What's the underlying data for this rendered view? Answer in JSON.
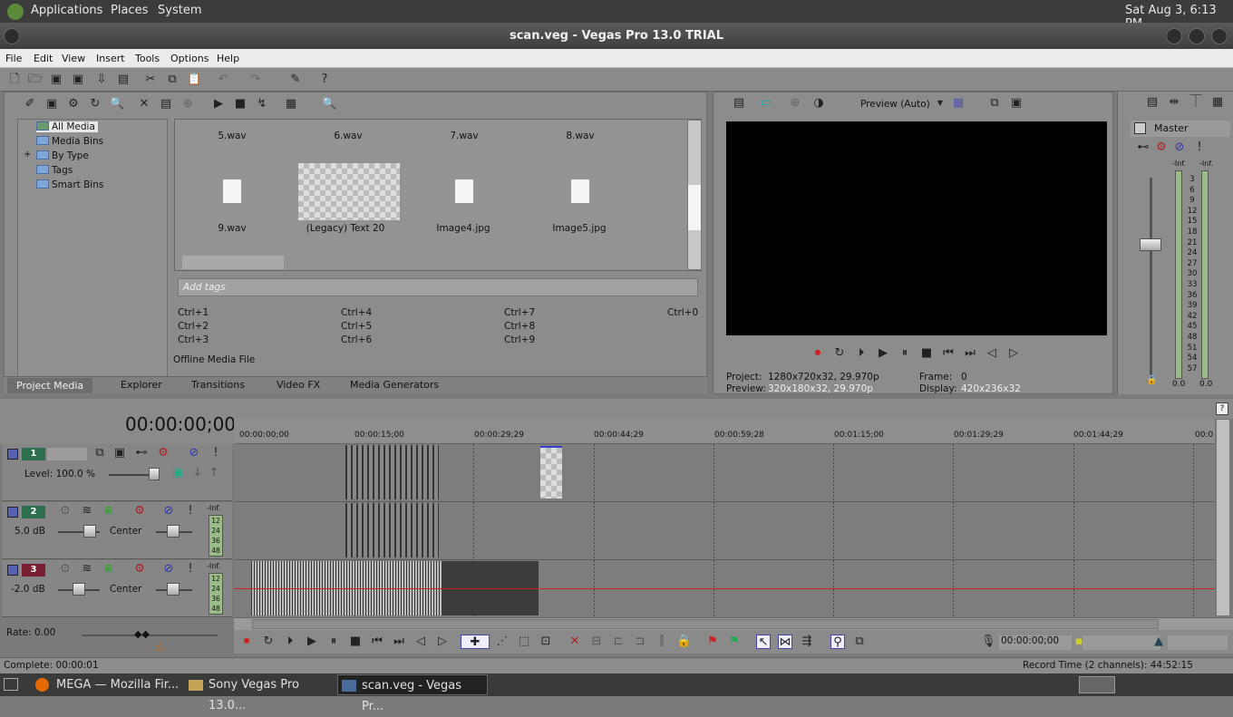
{
  "top_panel": {
    "applications": "Applications",
    "places": "Places",
    "system": "System",
    "clock": "Sat Aug  3,  6:13 PM"
  },
  "window": {
    "title": "scan.veg - Vegas Pro 13.0 TRIAL"
  },
  "menu": [
    "File",
    "Edit",
    "View",
    "Insert",
    "Tools",
    "Options",
    "Help"
  ],
  "media_tree": [
    "All Media",
    "Media Bins",
    "By Type",
    "Tags",
    "Smart Bins"
  ],
  "media_items": {
    "row1": [
      "5.wav",
      "6.wav",
      "7.wav",
      "8.wav"
    ],
    "row2": [
      "9.wav",
      "(Legacy) Text 20",
      "Image4.jpg",
      "Image5.jpg"
    ]
  },
  "tags_placeholder": "Add tags",
  "shortcuts": [
    "Ctrl+1",
    "Ctrl+2",
    "Ctrl+3",
    "Ctrl+4",
    "Ctrl+5",
    "Ctrl+6",
    "Ctrl+7",
    "Ctrl+8",
    "Ctrl+9",
    "Ctrl+0"
  ],
  "offline_label": "Offline Media File",
  "tabs": [
    "Project Media",
    "Explorer",
    "Transitions",
    "Video FX",
    "Media Generators"
  ],
  "preview": {
    "mode": "Preview (Auto)",
    "project_label": "Project:",
    "project_value": "1280x720x32, 29.970p",
    "preview_label": "Preview:",
    "preview_value": "320x180x32, 29.970p",
    "frame_label": "Frame:",
    "frame_value": "0",
    "display_label": "Display:",
    "display_value": "420x236x32"
  },
  "mixer": {
    "title": "Master",
    "inf_left": "-Inf.",
    "inf_right": "-Inf.",
    "scale": [
      "3",
      "6",
      "9",
      "12",
      "15",
      "18",
      "21",
      "24",
      "27",
      "30",
      "33",
      "36",
      "39",
      "42",
      "45",
      "48",
      "51",
      "54",
      "57"
    ],
    "val_left": "0.0",
    "val_right": "0.0"
  },
  "timecode": "00:00:00;00",
  "ruler": [
    "00:00:00;00",
    "00:00:15;00",
    "00:00:29;29",
    "00:00:44;29",
    "00:00:59;28",
    "00:01:15;00",
    "00:01:29;29",
    "00:01:44;29",
    "00:0"
  ],
  "tracks": [
    {
      "num": "1",
      "label": "Level: 100.0 %"
    },
    {
      "num": "2",
      "volume": "5.0 dB",
      "pan": "Center",
      "inf": "-Inf."
    },
    {
      "num": "3",
      "volume": "-2.0 dB",
      "pan": "Center",
      "inf": "-Inf."
    }
  ],
  "meter_scale": [
    "12",
    "24",
    "36",
    "48"
  ],
  "rate": "Rate: 0.00",
  "transport_time": "00:00:00;00",
  "status": {
    "complete": "Complete: 00:00:01",
    "record_time": "Record Time (2 channels): 44:52:15"
  },
  "taskbar": [
    {
      "label": "MEGA — Mozilla Fir..."
    },
    {
      "label": "Sony Vegas Pro 13.0..."
    },
    {
      "label": "scan.veg - Vegas Pr..."
    }
  ],
  "colors": {
    "track_video": "#2c6e4e",
    "track_audio2": "#2c6e4e",
    "track_audio3": "#7a1f33",
    "cursor_line": "#c22"
  }
}
